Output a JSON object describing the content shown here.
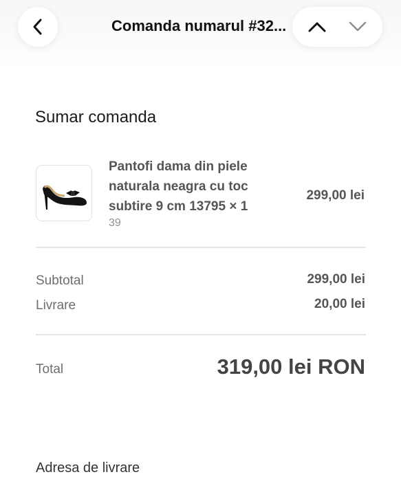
{
  "header": {
    "title": "Comanda numarul #32...",
    "back_icon": "chevron-left-icon",
    "prev_icon": "chevron-up-icon",
    "next_icon": "chevron-down-icon"
  },
  "summary": {
    "heading": "Sumar comanda",
    "items": [
      {
        "name": "Pantofi dama din piele naturala neagra cu toc subtire 9 cm 13795 × 1",
        "variant": "39",
        "price": "299,00 lei",
        "image_icon": "black-heel-shoe-image"
      }
    ]
  },
  "totals": {
    "subtotal_label": "Subtotal",
    "subtotal_value": "299,00 lei",
    "shipping_label": "Livrare",
    "shipping_value": "20,00 lei",
    "total_label": "Total",
    "total_value": "319,00 lei RON"
  },
  "shipping_address": {
    "heading": "Adresa de livrare"
  },
  "colors": {
    "background": "#ffffff",
    "divider": "#e4e4e4",
    "muted_text": "#6e6e6e",
    "strong_text": "#555555"
  }
}
